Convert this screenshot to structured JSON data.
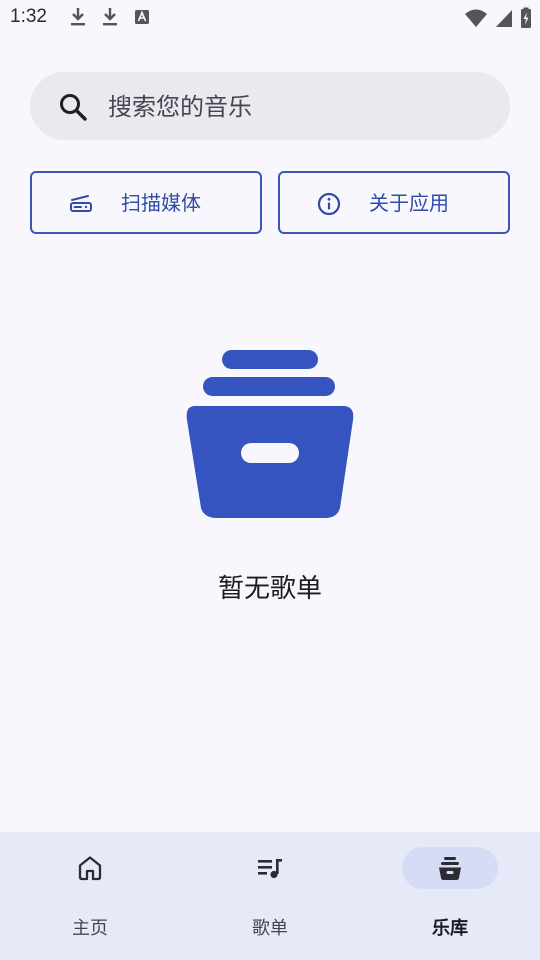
{
  "status_bar": {
    "time": "1:32",
    "left_icons": [
      "download-icon",
      "download-icon",
      "keyboard-a-icon"
    ],
    "right_icons": [
      "wifi-icon",
      "signal-icon",
      "battery-charging-icon"
    ]
  },
  "search": {
    "placeholder": "搜索您的音乐",
    "icon": "search-icon"
  },
  "actions": {
    "scan_label": "扫描媒体",
    "scan_icon": "scanner-icon",
    "about_label": "关于应用",
    "about_icon": "info-icon"
  },
  "empty_state": {
    "icon": "archive-box-icon",
    "message": "暂无歌单"
  },
  "bottom_nav": {
    "items": [
      {
        "label": "主页",
        "icon": "home-icon",
        "selected": false
      },
      {
        "label": "歌单",
        "icon": "playlist-icon",
        "selected": false
      },
      {
        "label": "乐库",
        "icon": "library-icon",
        "selected": true
      }
    ]
  },
  "colors": {
    "background": "#f8f7fd",
    "accent": "#3654bf",
    "search_bg": "#eae9f0",
    "nav_bg": "#e6e9f8",
    "nav_indicator": "#d6dcf5"
  }
}
